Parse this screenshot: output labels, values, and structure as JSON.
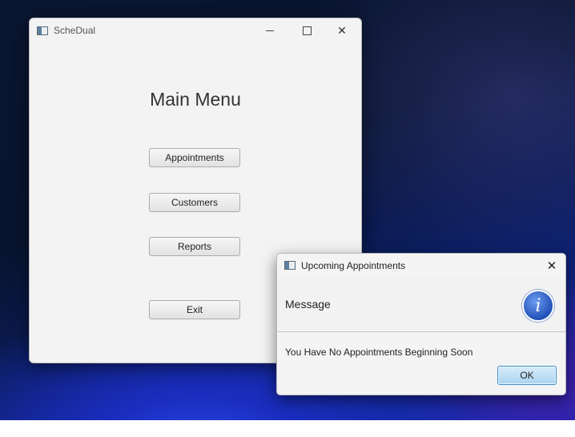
{
  "colors": {
    "window_bg": "#f3f3f3",
    "ok_button_bg": "#a9d3ef",
    "info_icon": "#2251b8"
  },
  "main_window": {
    "title": "ScheDual",
    "heading": "Main Menu",
    "buttons": [
      {
        "label": "Appointments"
      },
      {
        "label": "Customers"
      },
      {
        "label": "Reports"
      },
      {
        "label": "Exit"
      }
    ],
    "controls": {
      "minimize": "–",
      "maximize": "□",
      "close": "✕"
    }
  },
  "dialog": {
    "title": "Upcoming Appointments",
    "header": "Message",
    "icon": "info-icon",
    "icon_glyph": "i",
    "content": "You Have No Appointments Beginning Soon",
    "ok_label": "OK",
    "close": "✕"
  }
}
